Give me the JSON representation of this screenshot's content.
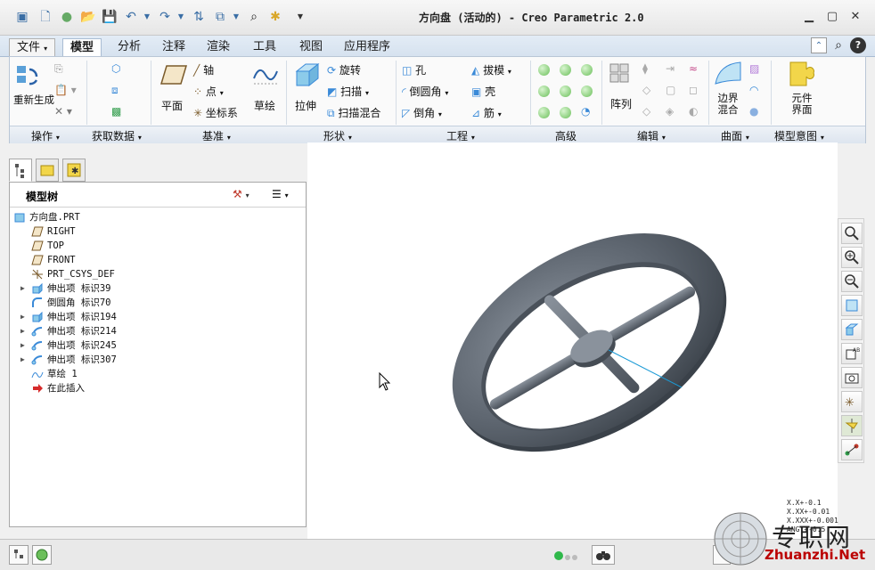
{
  "window": {
    "title": "方向盘 (活动的) - Creo Parametric 2.0"
  },
  "tabs": [
    "文件",
    "模型",
    "分析",
    "注释",
    "渲染",
    "工具",
    "视图",
    "应用程序"
  ],
  "ribbon": {
    "operations": {
      "regenerate": "重新生成",
      "label": "操作"
    },
    "getdata": {
      "label": "获取数据"
    },
    "datum": {
      "plane": "平面",
      "axis": "轴",
      "point": "点",
      "csys": "坐标系",
      "sketch": "草绘",
      "label": "基准"
    },
    "shapes": {
      "extrude": "拉伸",
      "revolve": "旋转",
      "sweep": "扫描",
      "swept_blend": "扫描混合",
      "label": "形状"
    },
    "engineering": {
      "hole": "孔",
      "round": "倒圆角",
      "chamfer": "倒角",
      "draft": "拔模",
      "shell": "壳",
      "rib": "筋",
      "label": "工程"
    },
    "advanced": {
      "label": "高级"
    },
    "editing": {
      "pattern": "阵列",
      "label": "编辑"
    },
    "surfaces": {
      "boundary_blend": "边界混合",
      "label": "曲面"
    },
    "model_intent": {
      "component_interface": "元件界面",
      "label": "模型意图"
    }
  },
  "model_tree": {
    "title": "模型树",
    "items": [
      {
        "text": "方向盘.PRT",
        "icon": "part-icon",
        "level": 0,
        "expandable": false
      },
      {
        "text": "RIGHT",
        "icon": "datum-plane-icon",
        "level": 1,
        "expandable": false
      },
      {
        "text": "TOP",
        "icon": "datum-plane-icon",
        "level": 1,
        "expandable": false
      },
      {
        "text": "FRONT",
        "icon": "datum-plane-icon",
        "level": 1,
        "expandable": false
      },
      {
        "text": "PRT_CSYS_DEF",
        "icon": "csys-icon",
        "level": 1,
        "expandable": false
      },
      {
        "text": "伸出项 标识39",
        "icon": "extrude-feature-icon",
        "level": 1,
        "expandable": true
      },
      {
        "text": "倒圆角 标识70",
        "icon": "round-feature-icon",
        "level": 1,
        "expandable": false
      },
      {
        "text": "伸出项 标识194",
        "icon": "extrude-feature-icon",
        "level": 1,
        "expandable": true
      },
      {
        "text": "伸出项 标识214",
        "icon": "sweep-feature-icon",
        "level": 1,
        "expandable": true
      },
      {
        "text": "伸出项 标识245",
        "icon": "sweep-feature-icon",
        "level": 1,
        "expandable": true
      },
      {
        "text": "伸出项 标识307",
        "icon": "sweep-feature-icon",
        "level": 1,
        "expandable": true
      },
      {
        "text": "草绘 1",
        "icon": "sketch-feature-icon",
        "level": 1,
        "expandable": false
      },
      {
        "text": "在此插入",
        "icon": "insert-here-arrow-icon",
        "level": 1,
        "expandable": false
      }
    ]
  },
  "tolerance_readout": [
    "X.X+-0.1",
    "X.XX+-0.01",
    "X.XXX+-0.001",
    "ANG.+-0.5"
  ],
  "watermark": {
    "cn": "专职网",
    "en": "Zhuanzhi.Net"
  },
  "colors": {
    "accent": "#3a6ea5",
    "model": "#5e6670",
    "datum_edge": "#1a9ad6"
  }
}
